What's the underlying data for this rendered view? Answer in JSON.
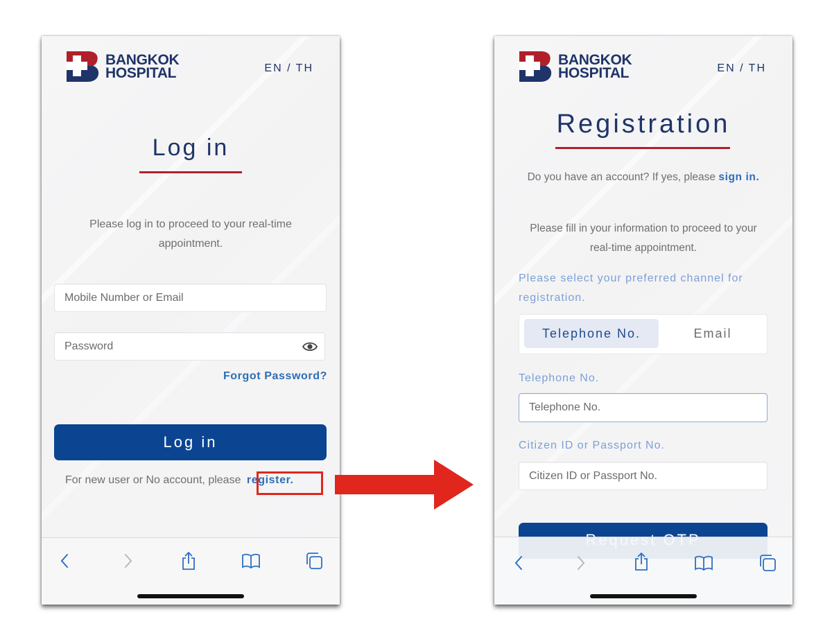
{
  "brand": {
    "name_line1": "BANGKOK",
    "name_line2": "HOSPITAL",
    "colors": {
      "navy": "#1f3468",
      "red": "#b0202b",
      "button_blue": "#0b4592",
      "link_blue": "#2e6db4"
    }
  },
  "login_screen": {
    "lang_toggle": "EN / TH",
    "title": "Log in",
    "subtitle": "Please log in to proceed to your real-time appointment.",
    "mobile_email_placeholder": "Mobile Number or Email",
    "password_placeholder": "Password",
    "show_password_icon": "eye-icon",
    "forgot_password": "Forgot Password?",
    "login_button": "Log in",
    "register_prompt": "For new user or No account, please",
    "register_link": "register."
  },
  "registration_screen": {
    "lang_toggle": "EN / TH",
    "title": "Registration",
    "have_account_prompt": "Do you have an account? If yes, please",
    "sign_in_link": "sign in.",
    "info_text": "Please fill in your information to proceed to your real-time appointment.",
    "channel_prompt": "Please select your preferred channel for registration.",
    "channel_options": [
      {
        "label": "Telephone No.",
        "selected": true
      },
      {
        "label": "Email",
        "selected": false
      }
    ],
    "telephone_label": "Telephone No.",
    "telephone_placeholder": "Telephone No.",
    "citizen_label": "Citizen ID or Passport No.",
    "citizen_placeholder": "Citizen ID or Passport No.",
    "request_otp_button": "Request OTP"
  },
  "browser_toolbar": {
    "icons": [
      "back-icon",
      "forward-icon",
      "share-icon",
      "bookmarks-icon",
      "tabs-icon"
    ]
  },
  "annotation": {
    "arrow_color": "#e0261d",
    "highlight": "register."
  }
}
